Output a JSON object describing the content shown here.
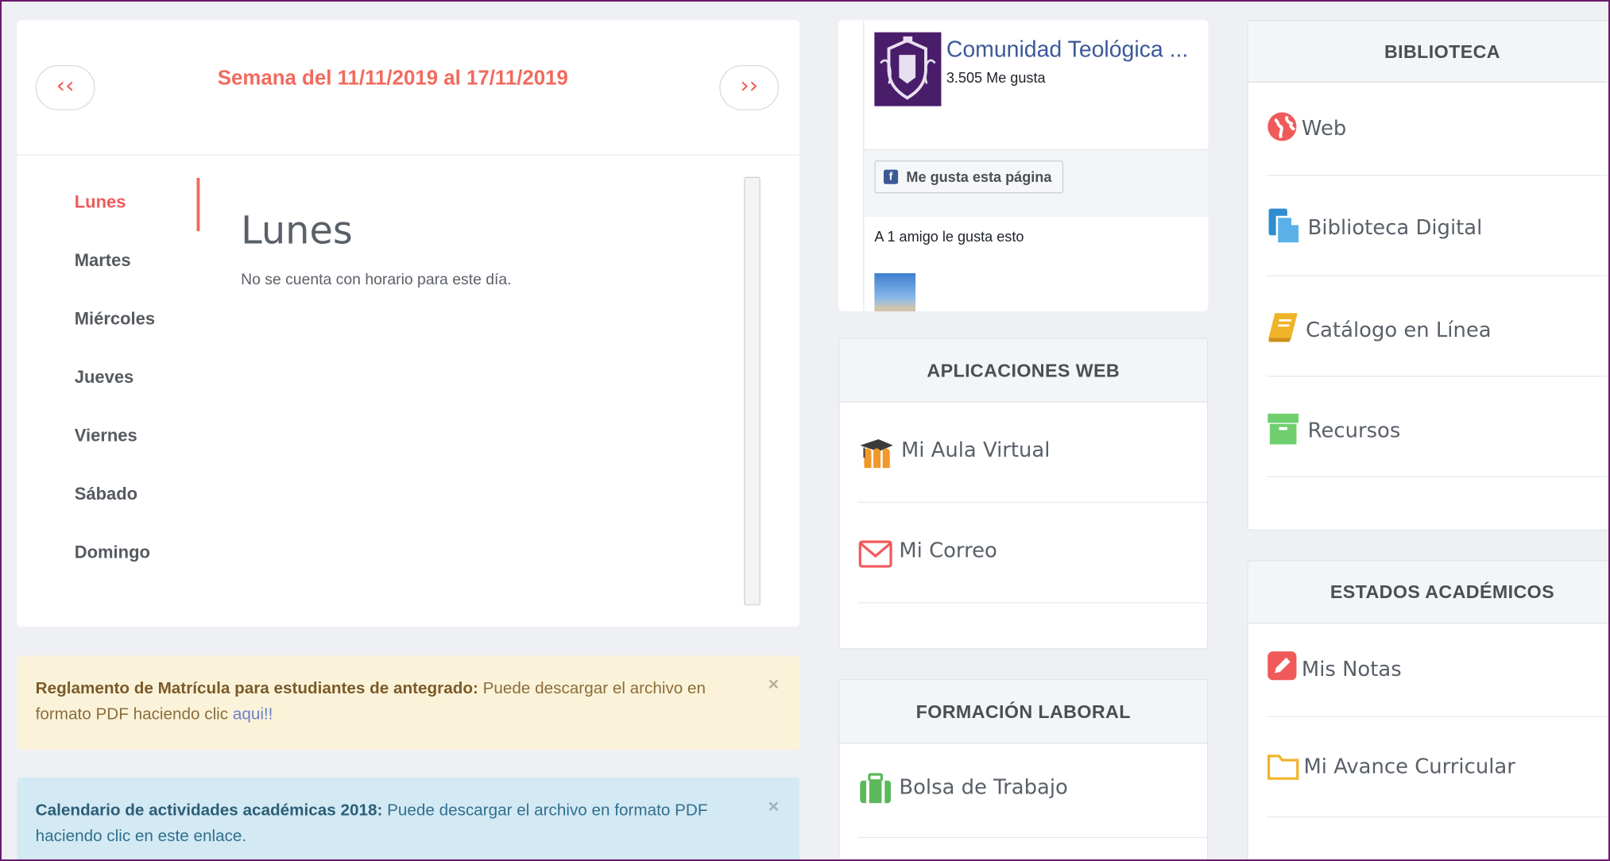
{
  "schedule": {
    "week_title": "Semana del 11/11/2019 al 17/11/2019",
    "prev_label": "‹‹",
    "next_label": "››",
    "days": [
      "Lunes",
      "Martes",
      "Miércoles",
      "Jueves",
      "Viernes",
      "Sábado",
      "Domingo"
    ],
    "selected_day": "Lunes",
    "day_heading": "Lunes",
    "day_message": "No se cuenta con horario para este día."
  },
  "alerts": [
    {
      "title": "Reglamento de Matrícula para estudiantes de antegrado:",
      "text": " Puede descargar el archivo en formato PDF haciendo clic ",
      "link": "aqui!!",
      "close": "×"
    },
    {
      "title": "Calendario de actividades académicas 2018:",
      "text": " Puede descargar el archivo en formato PDF haciendo clic en este enlace.",
      "link": "",
      "close": "×"
    }
  ],
  "facebook": {
    "page_name": "Comunidad Teológica ...",
    "likes": "3.505 Me gusta",
    "like_button": "Me gusta esta página",
    "friends_text": "A 1 amigo le gusta esto"
  },
  "apps": {
    "title": "APLICACIONES WEB",
    "items": [
      {
        "label": "Mi Aula Virtual",
        "icon": "moodle-icon"
      },
      {
        "label": "Mi Correo",
        "icon": "envelope-icon"
      }
    ]
  },
  "labor": {
    "title": "FORMACIÓN LABORAL",
    "items": [
      {
        "label": "Bolsa de Trabajo",
        "icon": "briefcase-icon"
      }
    ]
  },
  "library": {
    "title": "BIBLIOTECA",
    "items": [
      {
        "label": "Web",
        "icon": "globe-icon"
      },
      {
        "label": "Biblioteca Digital",
        "icon": "document-icon"
      },
      {
        "label": "Catálogo en Línea",
        "icon": "book-icon"
      },
      {
        "label": "Recursos",
        "icon": "archive-icon"
      }
    ]
  },
  "academic": {
    "title": "ESTADOS ACADÉMICOS",
    "items": [
      {
        "label": "Mis Notas",
        "icon": "pencil-icon"
      },
      {
        "label": "Mi Avance Curricular",
        "icon": "folder-icon"
      }
    ]
  },
  "colors": {
    "accent": "#f26a5e",
    "background": "#eef0f4",
    "facebook_blue": "#3b5998",
    "warning_bg": "#fbf3d9",
    "info_bg": "#d3e9f3"
  }
}
